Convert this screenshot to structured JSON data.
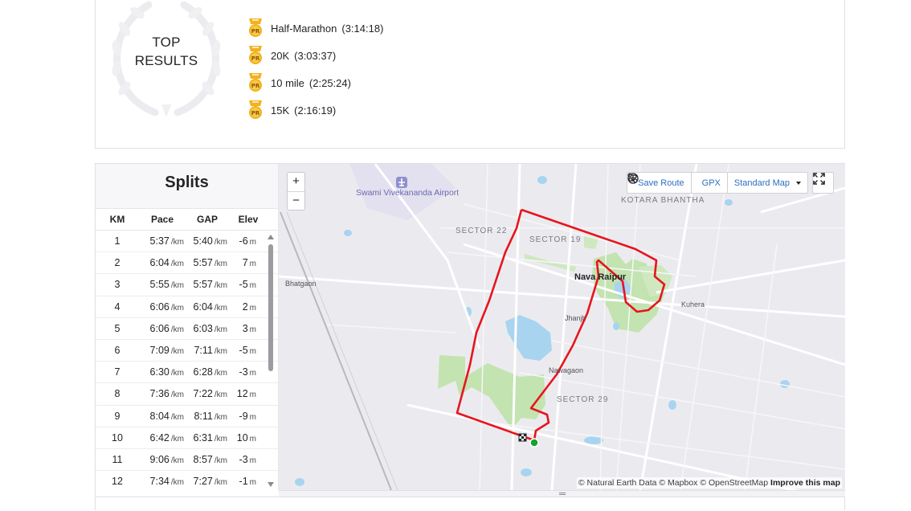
{
  "top_results": {
    "title_line1": "TOP",
    "title_line2": "RESULTS",
    "items": [
      {
        "name": "Half-Marathon",
        "time": "(3:14:18)"
      },
      {
        "name": "20K",
        "time": "(3:03:37)"
      },
      {
        "name": "10 mile",
        "time": "(2:25:24)"
      },
      {
        "name": "15K",
        "time": "(2:16:19)"
      }
    ]
  },
  "splits": {
    "title": "Splits",
    "headers": {
      "km": "KM",
      "pace": "Pace",
      "gap": "GAP",
      "elev": "Elev"
    },
    "unit_pace": "/km",
    "unit_elev": "m",
    "rows": [
      {
        "km": "1",
        "pace": "5:37",
        "gap": "5:40",
        "elev": "-6"
      },
      {
        "km": "2",
        "pace": "6:04",
        "gap": "5:57",
        "elev": "7"
      },
      {
        "km": "3",
        "pace": "5:55",
        "gap": "5:57",
        "elev": "-5"
      },
      {
        "km": "4",
        "pace": "6:06",
        "gap": "6:04",
        "elev": "2"
      },
      {
        "km": "5",
        "pace": "6:06",
        "gap": "6:03",
        "elev": "3"
      },
      {
        "km": "6",
        "pace": "7:09",
        "gap": "7:11",
        "elev": "-5"
      },
      {
        "km": "7",
        "pace": "6:30",
        "gap": "6:28",
        "elev": "-3"
      },
      {
        "km": "8",
        "pace": "7:36",
        "gap": "7:22",
        "elev": "12"
      },
      {
        "km": "9",
        "pace": "8:04",
        "gap": "8:11",
        "elev": "-9"
      },
      {
        "km": "10",
        "pace": "6:42",
        "gap": "6:31",
        "elev": "10"
      },
      {
        "km": "11",
        "pace": "9:06",
        "gap": "8:57",
        "elev": "-3"
      },
      {
        "km": "12",
        "pace": "7:34",
        "gap": "7:27",
        "elev": "-1"
      }
    ]
  },
  "map": {
    "zoom_in": "+",
    "zoom_out": "−",
    "save_route": "Save Route",
    "gpx": "GPX",
    "map_style": "Standard Map",
    "labels": {
      "airport": "Swami Vivekananda Airport",
      "kotara": "KOTARA BHANTHA",
      "sector22": "SECTOR 22",
      "sector19": "SECTOR 19",
      "sector29": "SECTOR 29",
      "nava_raipur": "Nava Raipur",
      "bhatgaon": "Bhatgaon",
      "kuhera": "Kuhera",
      "jhanjh": "Jhanjh",
      "nawagaon": "Nawagaon"
    },
    "attribution_text": "© Natural Earth Data © Mapbox © OpenStreetMap",
    "attribution_link": "Improve this map",
    "route_color": "#e8141d",
    "start_color": "#16a22a"
  },
  "colors": {
    "medal_gold": "#f2b21c",
    "link_blue": "#2a6fc0"
  }
}
